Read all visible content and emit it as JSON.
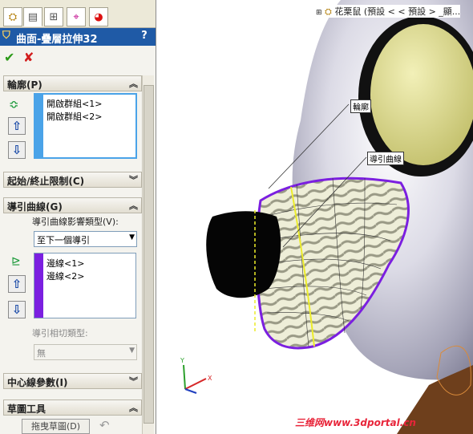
{
  "feature_title": "曲面-疊層拉伸32",
  "help_label": "?",
  "ok_icon": "check-icon",
  "cancel_icon": "cross-icon",
  "sections": {
    "profile": {
      "title": "輪廓(P)",
      "items": [
        "開啟群組<1>",
        "開啟群組<2>"
      ]
    },
    "start_end": {
      "title": "起始/終止限制(C)"
    },
    "guide": {
      "title": "導引曲線(G)",
      "influence_label": "導引曲線影響類型(V):",
      "influence_value": "至下一個導引",
      "items": [
        "邊線<1>",
        "邊線<2>"
      ],
      "tangency_label": "導引相切類型:",
      "tangency_value": "無"
    },
    "centerline": {
      "title": "中心線參數(I)"
    },
    "sketch_tools": {
      "title": "草圖工具",
      "drag_button": "拖曳草圖(D)"
    }
  },
  "tree": {
    "text": "花栗鼠 (預設 < < 預設 > _顯..."
  },
  "callouts": {
    "profile": "輪廓",
    "guide": "導引曲線"
  },
  "watermark": "三维网www.3dportal.cn",
  "colors": {
    "title_bg": "#1f5aa6",
    "selection": "#7b1fe0",
    "accent_blue": "#4aa3e8"
  }
}
